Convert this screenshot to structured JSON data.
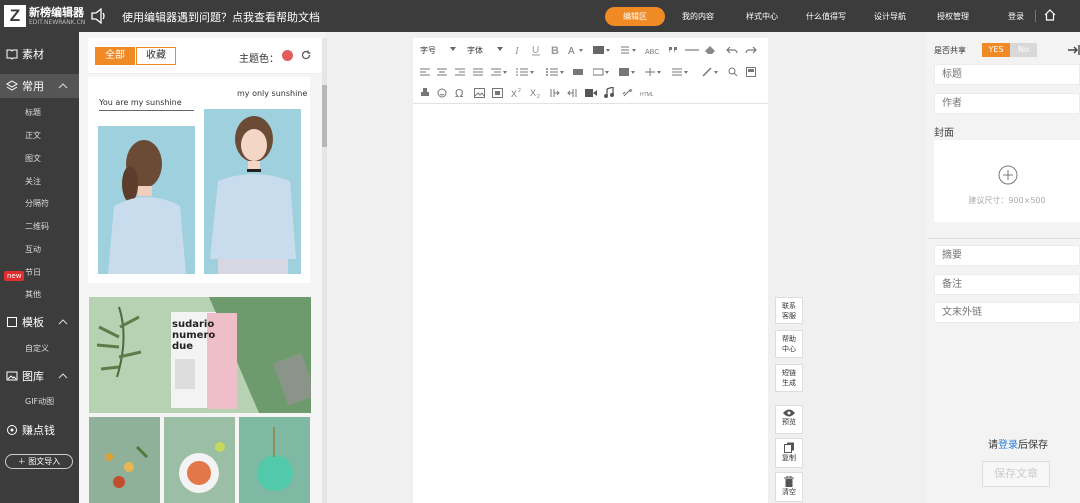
{
  "app": {
    "title": "新榜编辑器",
    "subtitle": "EDIT.NEWRANK.CN"
  },
  "header": {
    "notice": "使用编辑器遇到问题？点我查看帮助文档",
    "nav": [
      "编辑区",
      "我的内容",
      "样式中心",
      "什么值得写",
      "设计导航",
      "授权管理",
      "登录"
    ]
  },
  "sidebar": {
    "material": "素材",
    "common": "常用",
    "common_items": [
      "标题",
      "正文",
      "图文",
      "关注",
      "分隔符",
      "二维码",
      "互动",
      "节日",
      "其他"
    ],
    "new_badge": "new",
    "template": "模板",
    "template_items": [
      "自定义"
    ],
    "gallery": "图库",
    "gallery_items": [
      "GIF动图"
    ],
    "points": "赚点钱",
    "import": "图文导入"
  },
  "material_panel": {
    "tab_all": "全部",
    "tab_fav": "收藏",
    "theme_label": "主题色：",
    "theme_color": "#e25c5c",
    "card1_left_text": "You are my sunshine",
    "card1_right_text": "my only sunshine",
    "card2_text": [
      "sudario",
      "numero",
      "due"
    ]
  },
  "toolbar": {
    "font_size": "字号",
    "font_family": "字体"
  },
  "side_buttons": [
    {
      "line1": "联系",
      "line2": "客服"
    },
    {
      "line1": "帮助",
      "line2": "中心"
    },
    {
      "line1": "短链",
      "line2": "生成"
    },
    {
      "line1": "预览"
    },
    {
      "line1": "复制"
    },
    {
      "line1": "清空"
    }
  ],
  "right_panel": {
    "share_label": "是否共享",
    "yes": "YES",
    "no": "No",
    "title_placeholder": "标题",
    "author_placeholder": "作者",
    "cover_label": "封面",
    "cover_size": "建议尺寸：900×500",
    "summary_placeholder": "摘要",
    "note_placeholder": "备注",
    "link_placeholder": "文末外链",
    "login_prefix": "请",
    "login_link": "登录",
    "login_suffix": "后保存",
    "save_button": "保存文章"
  },
  "colors": {
    "accent": "#f08a24",
    "dark": "#3c3c3c",
    "link": "#2a7fd4"
  }
}
